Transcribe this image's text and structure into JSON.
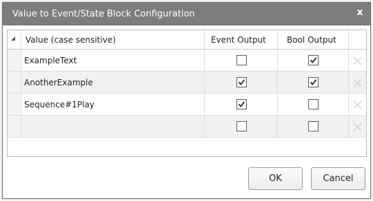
{
  "window": {
    "title": "Value to Event/State Block Configuration",
    "close_glyph": "x"
  },
  "grid": {
    "columns": [
      "Value (case sensitive)",
      "Event Output",
      "Bool Output"
    ],
    "rows": [
      {
        "value": "ExampleText",
        "event_output": false,
        "bool_output": true
      },
      {
        "value": "AnotherExample",
        "event_output": true,
        "bool_output": true
      },
      {
        "value": "Sequence#1Play",
        "event_output": true,
        "bool_output": false
      },
      {
        "value": "",
        "event_output": false,
        "bool_output": false
      }
    ],
    "delete_icon": "delete-x-icon"
  },
  "buttons": {
    "ok_label": "OK",
    "cancel_label": "Cancel"
  },
  "colors": {
    "titlebar": "#7d7d7d",
    "title_text": "#ffffff",
    "checkmark": "#222222",
    "delete_icon": "#d0d0d0"
  }
}
